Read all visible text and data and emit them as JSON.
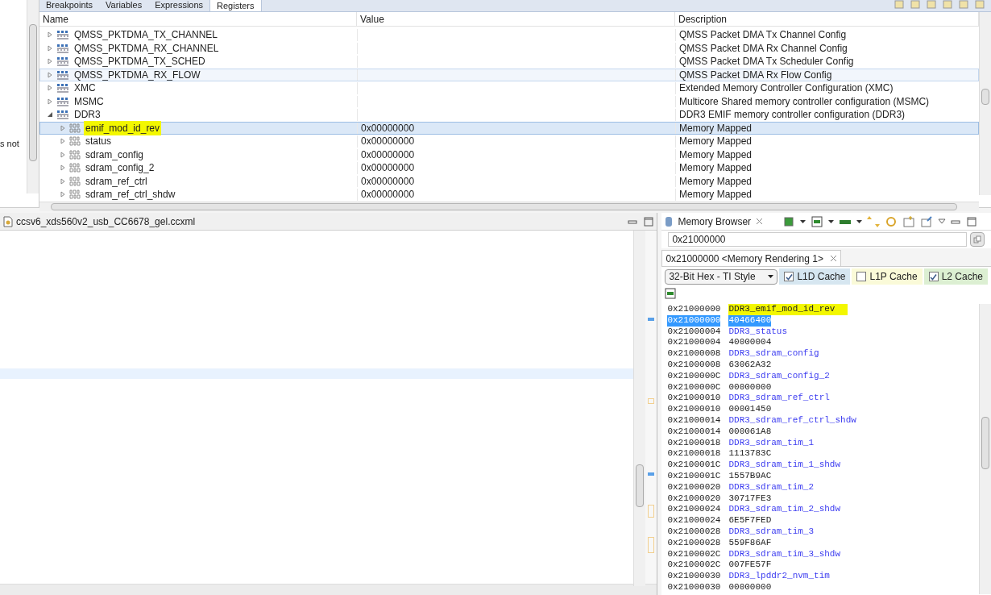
{
  "left_edge_text": "s not",
  "debug_tabs": [
    {
      "label": "Breakpoints",
      "selected": false
    },
    {
      "label": "Variables",
      "selected": false
    },
    {
      "label": "Expressions",
      "selected": false
    },
    {
      "label": "Registers",
      "selected": true
    }
  ],
  "registers": {
    "columns": [
      "Name",
      "Value",
      "Description"
    ],
    "rows": [
      {
        "kind": "group",
        "name": "QMSS_PKTDMA_TX_CHANNEL",
        "description": "QMSS Packet DMA Tx Channel Config",
        "expanded": false,
        "selected": false,
        "hovered": false,
        "highlighted": false
      },
      {
        "kind": "group",
        "name": "QMSS_PKTDMA_RX_CHANNEL",
        "description": "QMSS Packet DMA Rx Channel Config",
        "expanded": false,
        "selected": false,
        "hovered": false,
        "highlighted": false
      },
      {
        "kind": "group",
        "name": "QMSS_PKTDMA_TX_SCHED",
        "description": "QMSS Packet DMA Tx Scheduler Config",
        "expanded": false,
        "selected": false,
        "hovered": false,
        "highlighted": false
      },
      {
        "kind": "group",
        "name": "QMSS_PKTDMA_RX_FLOW",
        "description": "QMSS Packet DMA Rx Flow Config",
        "expanded": false,
        "selected": false,
        "hovered": true,
        "highlighted": false
      },
      {
        "kind": "group",
        "name": "XMC",
        "description": "Extended Memory Controller Configuration (XMC)",
        "expanded": false,
        "selected": false,
        "hovered": false,
        "highlighted": false
      },
      {
        "kind": "group",
        "name": "MSMC",
        "description": "Multicore Shared memory controller configuration (MSMC)",
        "expanded": false,
        "selected": false,
        "hovered": false,
        "highlighted": false
      },
      {
        "kind": "group",
        "name": "DDR3",
        "description": "DDR3 EMIF memory controller configuration (DDR3)",
        "expanded": true,
        "selected": false,
        "hovered": false,
        "highlighted": false,
        "children": [
          {
            "kind": "register",
            "name": "emif_mod_id_rev",
            "value": "0x00000000",
            "description": "Memory Mapped",
            "expanded": false,
            "selected": true,
            "highlighted": true
          },
          {
            "kind": "register",
            "name": "status",
            "value": "0x00000000",
            "description": "Memory Mapped",
            "expanded": false,
            "selected": false,
            "highlighted": false
          },
          {
            "kind": "register",
            "name": "sdram_config",
            "value": "0x00000000",
            "description": "Memory Mapped",
            "expanded": false,
            "selected": false,
            "highlighted": false
          },
          {
            "kind": "register",
            "name": "sdram_config_2",
            "value": "0x00000000",
            "description": "Memory Mapped",
            "expanded": false,
            "selected": false,
            "highlighted": false
          },
          {
            "kind": "register",
            "name": "sdram_ref_ctrl",
            "value": "0x00000000",
            "description": "Memory Mapped",
            "expanded": false,
            "selected": false,
            "highlighted": false
          },
          {
            "kind": "register",
            "name": "sdram_ref_ctrl_shdw",
            "value": "0x00000000",
            "description": "Memory Mapped",
            "expanded": false,
            "selected": false,
            "highlighted": false
          }
        ]
      }
    ]
  },
  "editor": {
    "tab_title": "ccsv6_xds560v2_usb_CC6678_gel.ccxml"
  },
  "memory_browser": {
    "tab_title": "Memory Browser",
    "address": "0x21000000",
    "rendering_tab": "0x21000000 <Memory Rendering 1>",
    "format": "32-Bit Hex - TI Style",
    "caches": [
      {
        "label": "L1D Cache",
        "checked": true,
        "color": "#d6e6f0"
      },
      {
        "label": "L1P Cache",
        "checked": false,
        "color": "#fafad8"
      },
      {
        "label": "L2 Cache",
        "checked": true,
        "color": "#dcefd2"
      }
    ],
    "lines": [
      {
        "kind": "label",
        "address": "0x21000000",
        "text": "DDR3_emif_mod_id_rev",
        "selected": false,
        "highlighted": true
      },
      {
        "kind": "value",
        "address": "0x21000000",
        "text": "40466400",
        "selected": true,
        "highlighted": false
      },
      {
        "kind": "label",
        "address": "0x21000004",
        "text": "DDR3_status",
        "selected": false,
        "highlighted": false
      },
      {
        "kind": "value",
        "address": "0x21000004",
        "text": "40000004",
        "selected": false,
        "highlighted": false
      },
      {
        "kind": "label",
        "address": "0x21000008",
        "text": "DDR3_sdram_config",
        "selected": false,
        "highlighted": false
      },
      {
        "kind": "value",
        "address": "0x21000008",
        "text": "63062A32",
        "selected": false,
        "highlighted": false
      },
      {
        "kind": "label",
        "address": "0x2100000C",
        "text": "DDR3_sdram_config_2",
        "selected": false,
        "highlighted": false
      },
      {
        "kind": "value",
        "address": "0x2100000C",
        "text": "00000000",
        "selected": false,
        "highlighted": false
      },
      {
        "kind": "label",
        "address": "0x21000010",
        "text": "DDR3_sdram_ref_ctrl",
        "selected": false,
        "highlighted": false
      },
      {
        "kind": "value",
        "address": "0x21000010",
        "text": "00001450",
        "selected": false,
        "highlighted": false
      },
      {
        "kind": "label",
        "address": "0x21000014",
        "text": "DDR3_sdram_ref_ctrl_shdw",
        "selected": false,
        "highlighted": false
      },
      {
        "kind": "value",
        "address": "0x21000014",
        "text": "000061A8",
        "selected": false,
        "highlighted": false
      },
      {
        "kind": "label",
        "address": "0x21000018",
        "text": "DDR3_sdram_tim_1",
        "selected": false,
        "highlighted": false
      },
      {
        "kind": "value",
        "address": "0x21000018",
        "text": "1113783C",
        "selected": false,
        "highlighted": false
      },
      {
        "kind": "label",
        "address": "0x2100001C",
        "text": "DDR3_sdram_tim_1_shdw",
        "selected": false,
        "highlighted": false
      },
      {
        "kind": "value",
        "address": "0x2100001C",
        "text": "1557B9AC",
        "selected": false,
        "highlighted": false
      },
      {
        "kind": "label",
        "address": "0x21000020",
        "text": "DDR3_sdram_tim_2",
        "selected": false,
        "highlighted": false
      },
      {
        "kind": "value",
        "address": "0x21000020",
        "text": "30717FE3",
        "selected": false,
        "highlighted": false
      },
      {
        "kind": "label",
        "address": "0x21000024",
        "text": "DDR3_sdram_tim_2_shdw",
        "selected": false,
        "highlighted": false
      },
      {
        "kind": "value",
        "address": "0x21000024",
        "text": "6E5F7FED",
        "selected": false,
        "highlighted": false
      },
      {
        "kind": "label",
        "address": "0x21000028",
        "text": "DDR3_sdram_tim_3",
        "selected": false,
        "highlighted": false
      },
      {
        "kind": "value",
        "address": "0x21000028",
        "text": "559F86AF",
        "selected": false,
        "highlighted": false
      },
      {
        "kind": "label",
        "address": "0x2100002C",
        "text": "DDR3_sdram_tim_3_shdw",
        "selected": false,
        "highlighted": false
      },
      {
        "kind": "value",
        "address": "0x2100002C",
        "text": "007FE57F",
        "selected": false,
        "highlighted": false
      },
      {
        "kind": "label",
        "address": "0x21000030",
        "text": "DDR3_lpddr2_nvm_tim",
        "selected": false,
        "highlighted": false
      },
      {
        "kind": "value",
        "address": "0x21000030",
        "text": "00000000",
        "selected": false,
        "highlighted": false
      }
    ]
  }
}
